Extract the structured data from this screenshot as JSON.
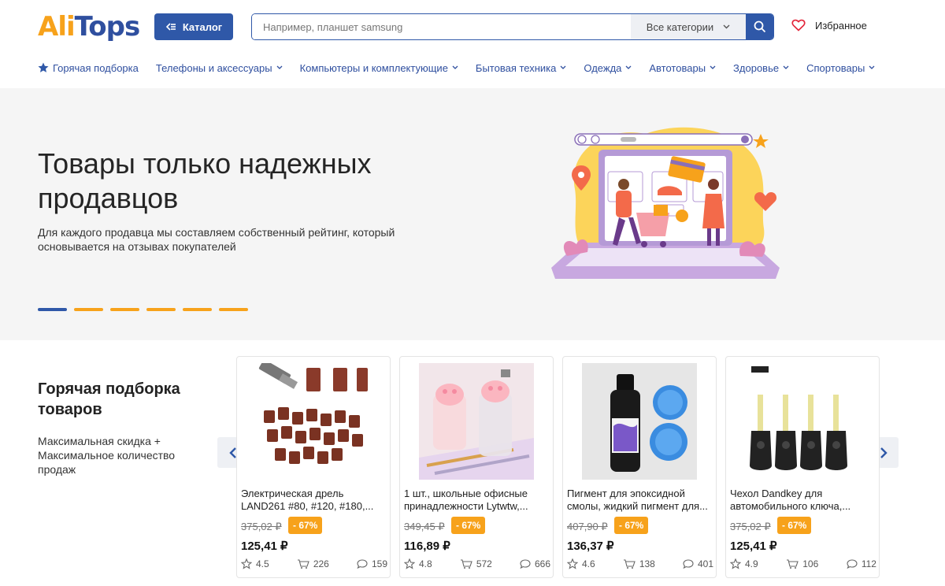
{
  "header": {
    "logo_part1": "Ali",
    "logo_part2": "Tops",
    "catalog_label": "Каталог",
    "search_placeholder": "Например, планшет samsung",
    "category_select": "Все категории",
    "favorites_label": "Избранное"
  },
  "nav": {
    "items": [
      {
        "label": "Горячая подборка",
        "icon": "star-icon"
      },
      {
        "label": "Телефоны и аксессуары"
      },
      {
        "label": "Компьютеры и комплектующие"
      },
      {
        "label": "Бытовая техника"
      },
      {
        "label": "Одежда"
      },
      {
        "label": "Автотовары"
      },
      {
        "label": "Здоровье"
      },
      {
        "label": "Спортовары"
      }
    ]
  },
  "banner": {
    "title": "Товары только надежных продавцов",
    "subtitle": "Для каждого продавца мы составляем собственный рейтинг, который основывается на отзывах покупателей",
    "slides_count": 6,
    "active_slide": 0
  },
  "hot": {
    "title": "Горячая подборка товаров",
    "subtitle": "Максимальная скидка + Максимальное количество продаж"
  },
  "products": [
    {
      "title": "Электрическая дрель LAND261 #80, #120, #180,...",
      "old_price": "375,02 ₽",
      "discount": "- 67%",
      "price": "125,41 ₽",
      "rating": "4.5",
      "orders": "226",
      "reviews": "159"
    },
    {
      "title": "1 шт., школьные офисные принадлежности Lytwtw,...",
      "old_price": "349,45 ₽",
      "discount": "- 67%",
      "price": "116,89 ₽",
      "rating": "4.8",
      "orders": "572",
      "reviews": "666"
    },
    {
      "title": "Пигмент для эпоксидной смолы, жидкий пигмент для...",
      "old_price": "407,90 ₽",
      "discount": "- 67%",
      "price": "136,37 ₽",
      "rating": "4.6",
      "orders": "138",
      "reviews": "401"
    },
    {
      "title": "Чехол Dandkey для автомобильного ключа,...",
      "old_price": "375,02 ₽",
      "discount": "- 67%",
      "price": "125,41 ₽",
      "rating": "4.9",
      "orders": "106",
      "reviews": "112"
    }
  ],
  "colors": {
    "brand_blue": "#2f58a8",
    "brand_orange": "#f7a21b"
  }
}
